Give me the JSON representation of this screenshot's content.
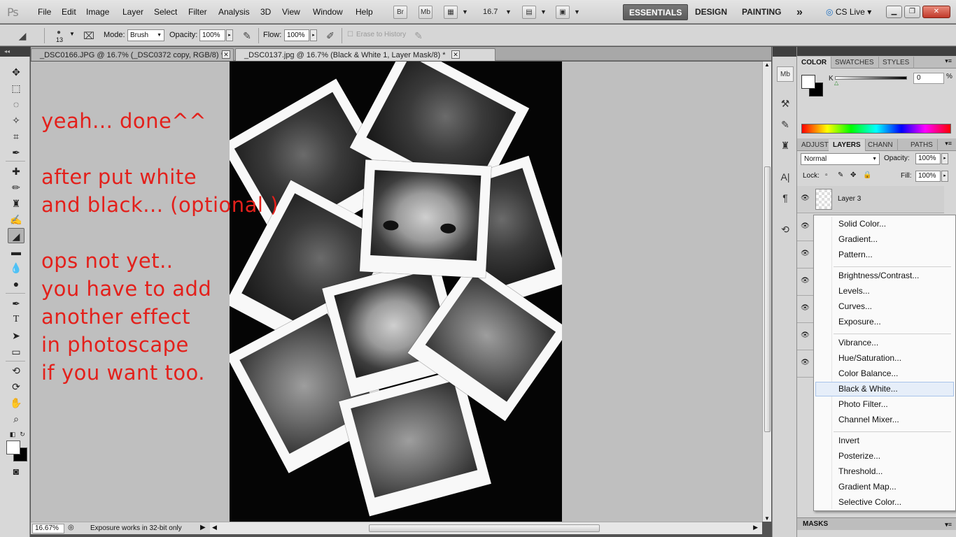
{
  "app_logo": "Ps",
  "menu": [
    "File",
    "Edit",
    "Image",
    "Layer",
    "Select",
    "Filter",
    "Analysis",
    "3D",
    "View",
    "Window",
    "Help"
  ],
  "appbar": {
    "bridge": "Br",
    "minibridge": "Mb",
    "zoom": "16.7",
    "workspaces": [
      "ESSENTIALS",
      "DESIGN",
      "PAINTING"
    ],
    "more": "»",
    "cslive": "CS Live"
  },
  "options": {
    "brush_size": "13",
    "mode_label": "Mode:",
    "mode_value": "Brush",
    "opacity_label": "Opacity:",
    "opacity_value": "100%",
    "flow_label": "Flow:",
    "flow_value": "100%",
    "erase_history": "Erase to History"
  },
  "tabs": [
    {
      "label": "_DSC0166.JPG @ 16.7% (_DSC0372 copy, RGB/8) *"
    },
    {
      "label": "_DSC0137.jpg @ 16.7% (Black & White 1, Layer Mask/8) *"
    }
  ],
  "overlay_text": "yeah... done^^\n\nafter put white\nand black... (optional )\n\nops not yet..\nyou have to add\nanother effect\nin photoscape\nif you want too.",
  "status": {
    "zoom": "16.67%",
    "message": "Exposure works in 32-bit only"
  },
  "panels": {
    "color_tabs": [
      "COLOR",
      "SWATCHES",
      "STYLES"
    ],
    "k_label": "K",
    "k_value": "0",
    "k_unit": "%",
    "layer_tabs": [
      "ADJUST",
      "LAYERS",
      "CHANN",
      "PATHS"
    ],
    "blend_mode": "Normal",
    "opacity_label": "Opacity:",
    "opacity_value": "100%",
    "lock_label": "Lock:",
    "fill_label": "Fill:",
    "fill_value": "100%",
    "layer_name": "Layer 3",
    "masks": "MASKS"
  },
  "dropdown": [
    [
      "Solid Color...",
      "Gradient...",
      "Pattern..."
    ],
    [
      "Brightness/Contrast...",
      "Levels...",
      "Curves...",
      "Exposure..."
    ],
    [
      "Vibrance...",
      "Hue/Saturation...",
      "Color Balance...",
      "Black & White...",
      "Photo Filter...",
      "Channel Mixer..."
    ],
    [
      "Invert",
      "Posterize...",
      "Threshold...",
      "Gradient Map...",
      "Selective Color..."
    ]
  ],
  "dropdown_highlighted": "Black & White..."
}
